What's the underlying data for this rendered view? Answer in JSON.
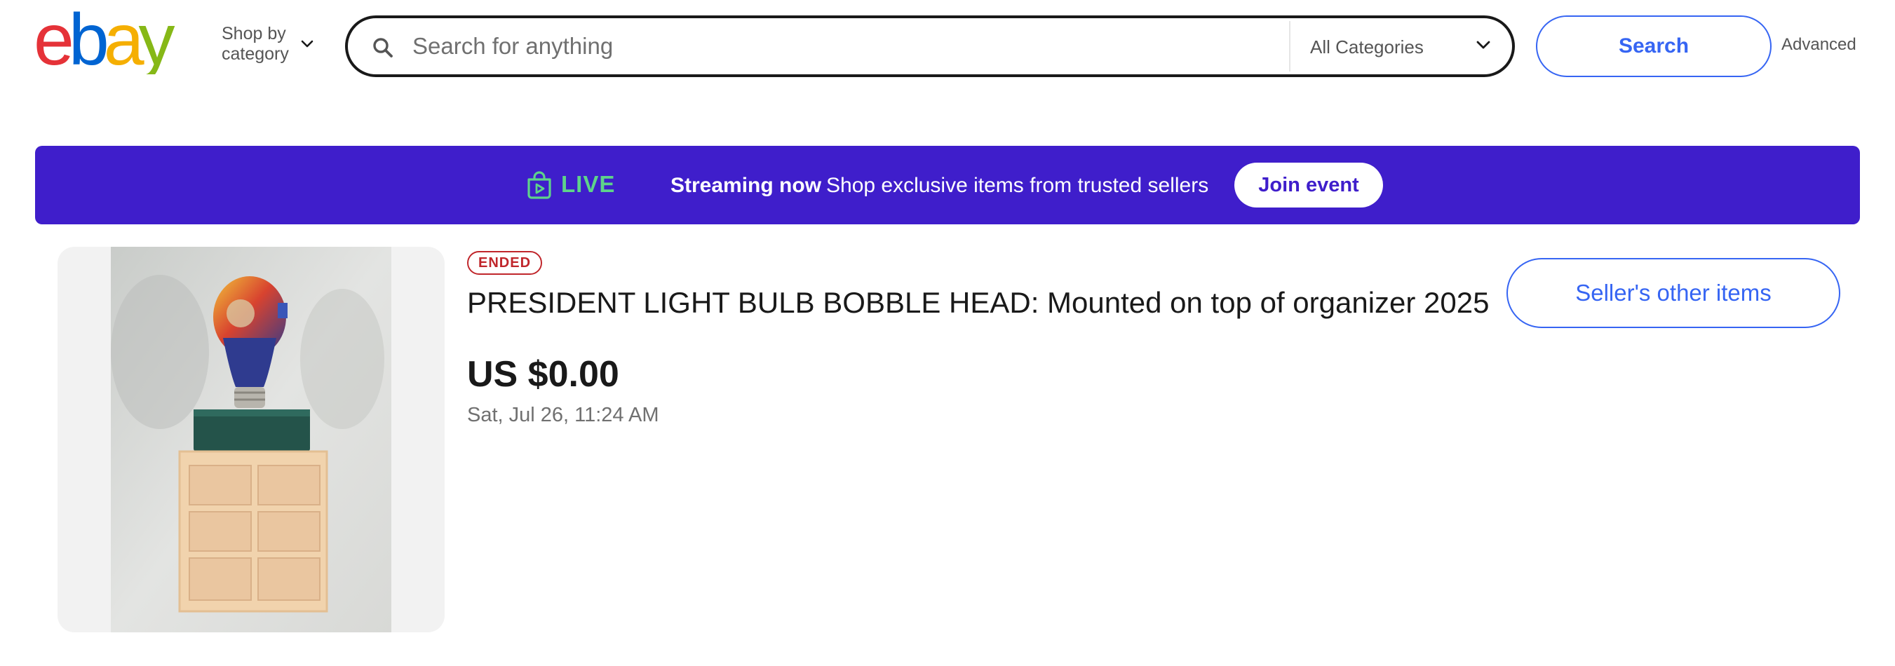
{
  "header": {
    "logo_text": "ebay",
    "shop_by_category_line1": "Shop by",
    "shop_by_category_line2": "category",
    "search": {
      "placeholder": "Search for anything",
      "value": "",
      "category_selected": "All Categories"
    },
    "search_button_label": "Search",
    "advanced_link": "Advanced"
  },
  "live_banner": {
    "live_label": "LIVE",
    "streaming_label": "Streaming now",
    "description": "Shop exclusive items from trusted sellers",
    "join_button_label": "Join event",
    "background_color": "#3f1ecb",
    "accent_color": "#5ed38a"
  },
  "listing": {
    "status_badge": "ENDED",
    "title": "PRESIDENT LIGHT BULB BOBBLE HEAD: Mounted on top of organizer 2025",
    "price": "US $0.00",
    "date": "Sat, Jul 26, 11:24 AM",
    "seller_button_label": "Seller's other items"
  },
  "icons": {
    "search": "search-icon",
    "category_chevron": "chevron-down-icon",
    "shop_by_chevron": "chevron-down-icon",
    "live": "live-shopping-bag-icon"
  },
  "colors": {
    "accent_blue": "#3665f3",
    "ended_red": "#c0262b",
    "logo_red": "#e53238",
    "logo_blue": "#0064d2",
    "logo_yellow": "#f5af02",
    "logo_green": "#86b817"
  }
}
